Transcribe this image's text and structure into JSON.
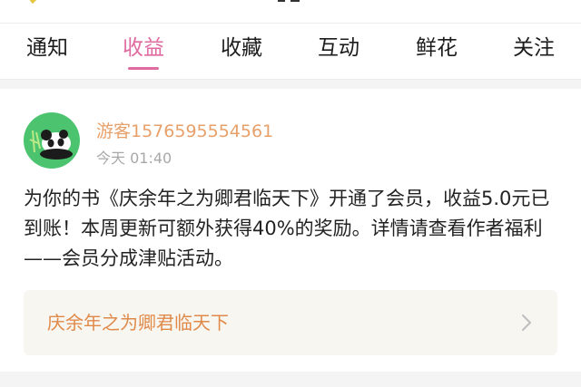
{
  "tabs": [
    {
      "label": "通知"
    },
    {
      "label": "收益"
    },
    {
      "label": "收藏"
    },
    {
      "label": "互动"
    },
    {
      "label": "鲜花"
    },
    {
      "label": "关注"
    }
  ],
  "active_tab": "收益",
  "colors": {
    "accent": "#e06aa0",
    "username": "#e8a06a",
    "book_title": "#e08a4a",
    "avatar_bg": "#4cc46f"
  },
  "notification": {
    "username": "游客1576595554561",
    "time": "今天 01:40",
    "message": "为你的书《庆余年之为卿君临天下》开通了会员，收益5.0元已到账！本周更新可额外获得40%的奖励。详情请查看作者福利——会员分成津贴活动。",
    "book_title": "庆余年之为卿君临天下"
  },
  "icons": {
    "back": "back-arrow-icon",
    "avatar": "panda-avatar-icon",
    "chevron": "chevron-right-icon"
  }
}
